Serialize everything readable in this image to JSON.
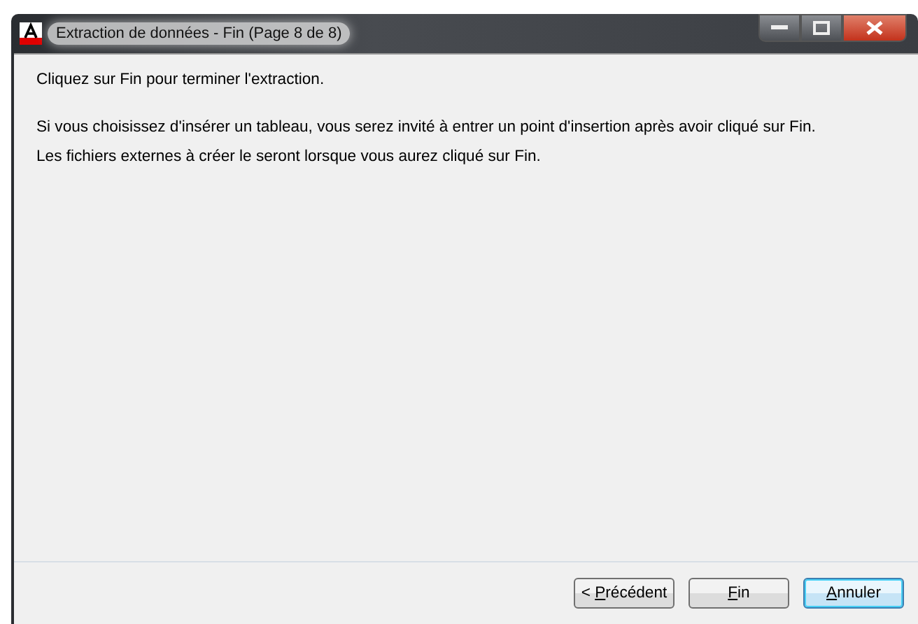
{
  "window": {
    "title": "Extraction de données - Fin (Page 8 de 8)"
  },
  "messages": [
    "Cliquez sur Fin pour terminer l'extraction.",
    "Si vous choisissez d'insérer un tableau, vous serez invité à entrer un point d'insertion après avoir cliqué sur Fin.",
    "Les fichiers externes à créer le seront lorsque vous aurez cliqué sur Fin."
  ],
  "buttons": [
    {
      "pre": "< ",
      "key": "P",
      "post": "récédent",
      "default": false
    },
    {
      "key": "F",
      "post": "in",
      "default": false
    },
    {
      "key": "A",
      "post": "nnuler",
      "default": true
    }
  ]
}
